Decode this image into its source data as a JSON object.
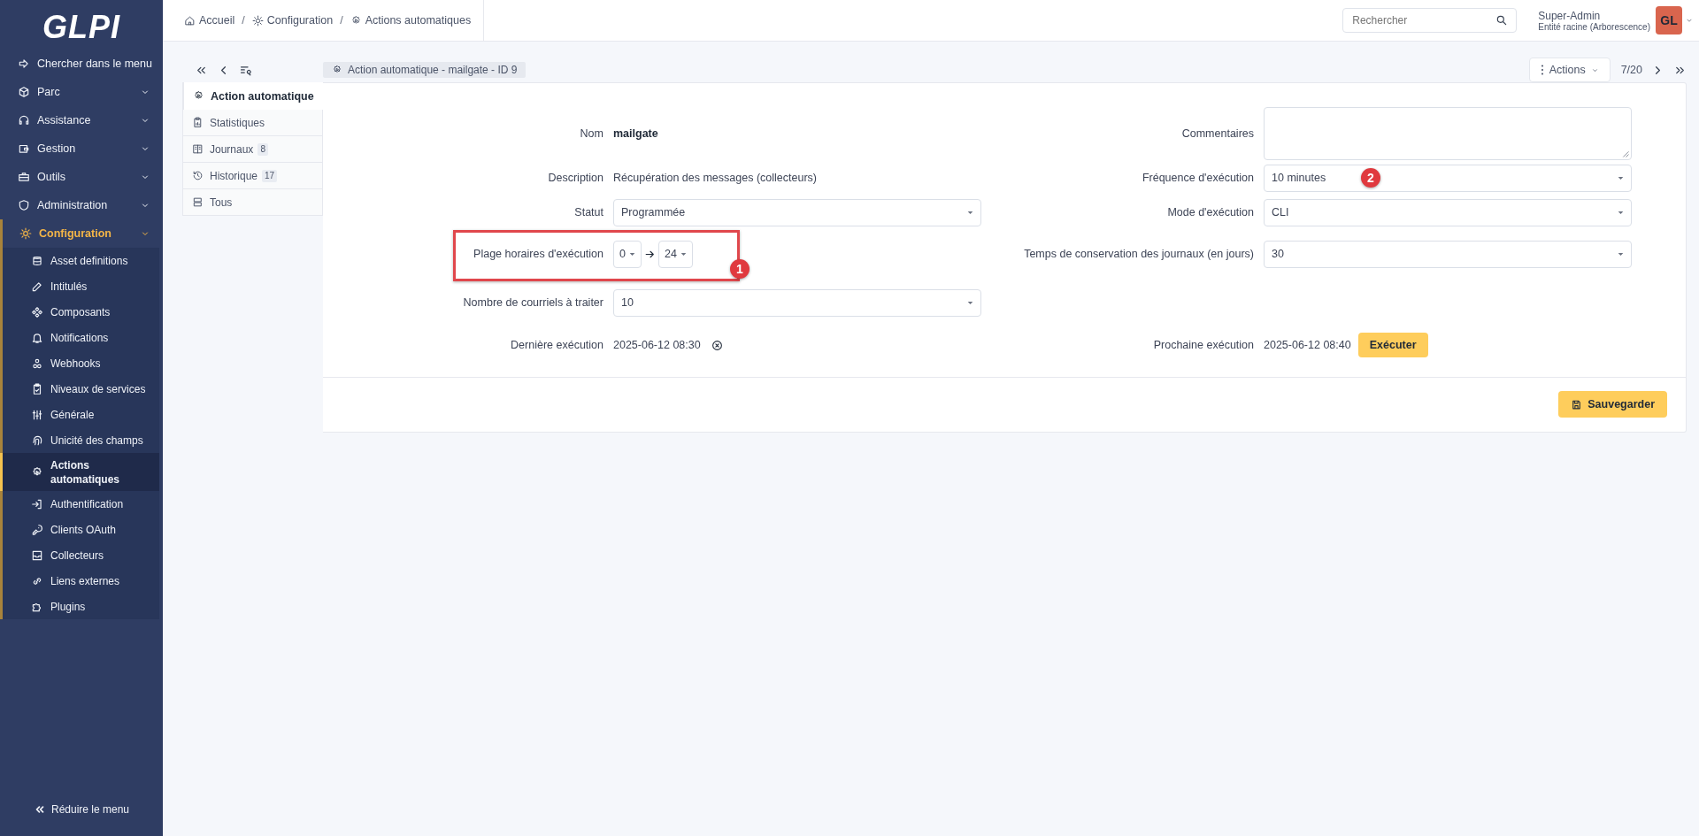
{
  "sidebar": {
    "logo": "GLPI",
    "items": [
      {
        "label": "Chercher dans le menu",
        "kind": "search"
      },
      {
        "label": "Parc",
        "kind": "menu",
        "selected": false
      },
      {
        "label": "Assistance",
        "kind": "menu",
        "selected": false
      },
      {
        "label": "Gestion",
        "kind": "menu",
        "selected": false
      },
      {
        "label": "Outils",
        "kind": "menu",
        "selected": false
      },
      {
        "label": "Administration",
        "kind": "menu",
        "selected": false
      },
      {
        "label": "Configuration",
        "kind": "menu",
        "selected": true,
        "children": [
          {
            "label": "Asset definitions",
            "selected": false
          },
          {
            "label": "Intitulés",
            "selected": false
          },
          {
            "label": "Composants",
            "selected": false
          },
          {
            "label": "Notifications",
            "selected": false
          },
          {
            "label": "Webhooks",
            "selected": false
          },
          {
            "label": "Niveaux de services",
            "selected": false
          },
          {
            "label": "Générale",
            "selected": false
          },
          {
            "label": "Unicité des champs",
            "selected": false
          },
          {
            "label": "Actions automatiques",
            "selected": true
          },
          {
            "label": "Authentification",
            "selected": false
          },
          {
            "label": "Clients OAuth",
            "selected": false
          },
          {
            "label": "Collecteurs",
            "selected": false
          },
          {
            "label": "Liens externes",
            "selected": false
          },
          {
            "label": "Plugins",
            "selected": false
          }
        ]
      }
    ],
    "collapse": "Réduire le menu"
  },
  "header": {
    "breadcrumb": [
      "Accueil",
      "Configuration",
      "Actions automatiques"
    ],
    "breadcrumb_separator": "/",
    "search": {
      "placeholder": "Rechercher"
    },
    "user": {
      "name": "Super-Admin",
      "entity": "Entité racine (Arborescence)",
      "initials": "GL"
    }
  },
  "toolbar": {
    "title": "Action automatique -  mailgate - ID 9",
    "actions": "Actions",
    "position": "7/20"
  },
  "tabs": [
    {
      "label": "Action automatique",
      "selected": true
    },
    {
      "label": "Statistiques",
      "selected": false
    },
    {
      "label": "Journaux",
      "count": "8",
      "selected": false
    },
    {
      "label": "Historique",
      "count": "17",
      "selected": false
    },
    {
      "label": "Tous",
      "selected": false
    }
  ],
  "form": {
    "rows": [
      {
        "left": {
          "label": "Nom",
          "kind": "text",
          "value": "mailgate",
          "strong": true
        },
        "right": {
          "label": "Commentaires",
          "kind": "textarea"
        }
      },
      {
        "left": {
          "label": "Description",
          "kind": "text",
          "value": "Récupération des messages (collecteurs)",
          "strong": false
        },
        "right": {
          "label": "Fréquence d'exécution",
          "kind": "select",
          "value": "10 minutes",
          "badge": "2"
        }
      },
      {
        "left": {
          "label": "Statut",
          "kind": "select",
          "value": "Programmée"
        },
        "right": {
          "label": "Mode d'exécution",
          "kind": "select",
          "value": "CLI"
        }
      },
      {
        "left": {
          "label": "Plage horaires d'exécution",
          "kind": "range",
          "from": "0",
          "to": "24",
          "highlighted": true,
          "badge": "1"
        },
        "right": {
          "label": "Temps de conservation des journaux (en jours)",
          "kind": "select",
          "value": "30"
        }
      },
      {
        "left": {
          "label": "Nombre de courriels à traiter",
          "kind": "select",
          "value": "10"
        }
      },
      {
        "left": {
          "label": "Dernière exécution",
          "kind": "datetime",
          "value": "2025-06-12 08:30",
          "clearable": true
        },
        "right": {
          "label": "Prochaine exécution",
          "kind": "datetime",
          "value": "2025-06-12 08:40",
          "action": "Exécuter"
        }
      }
    ],
    "save": "Sauvegarder"
  }
}
